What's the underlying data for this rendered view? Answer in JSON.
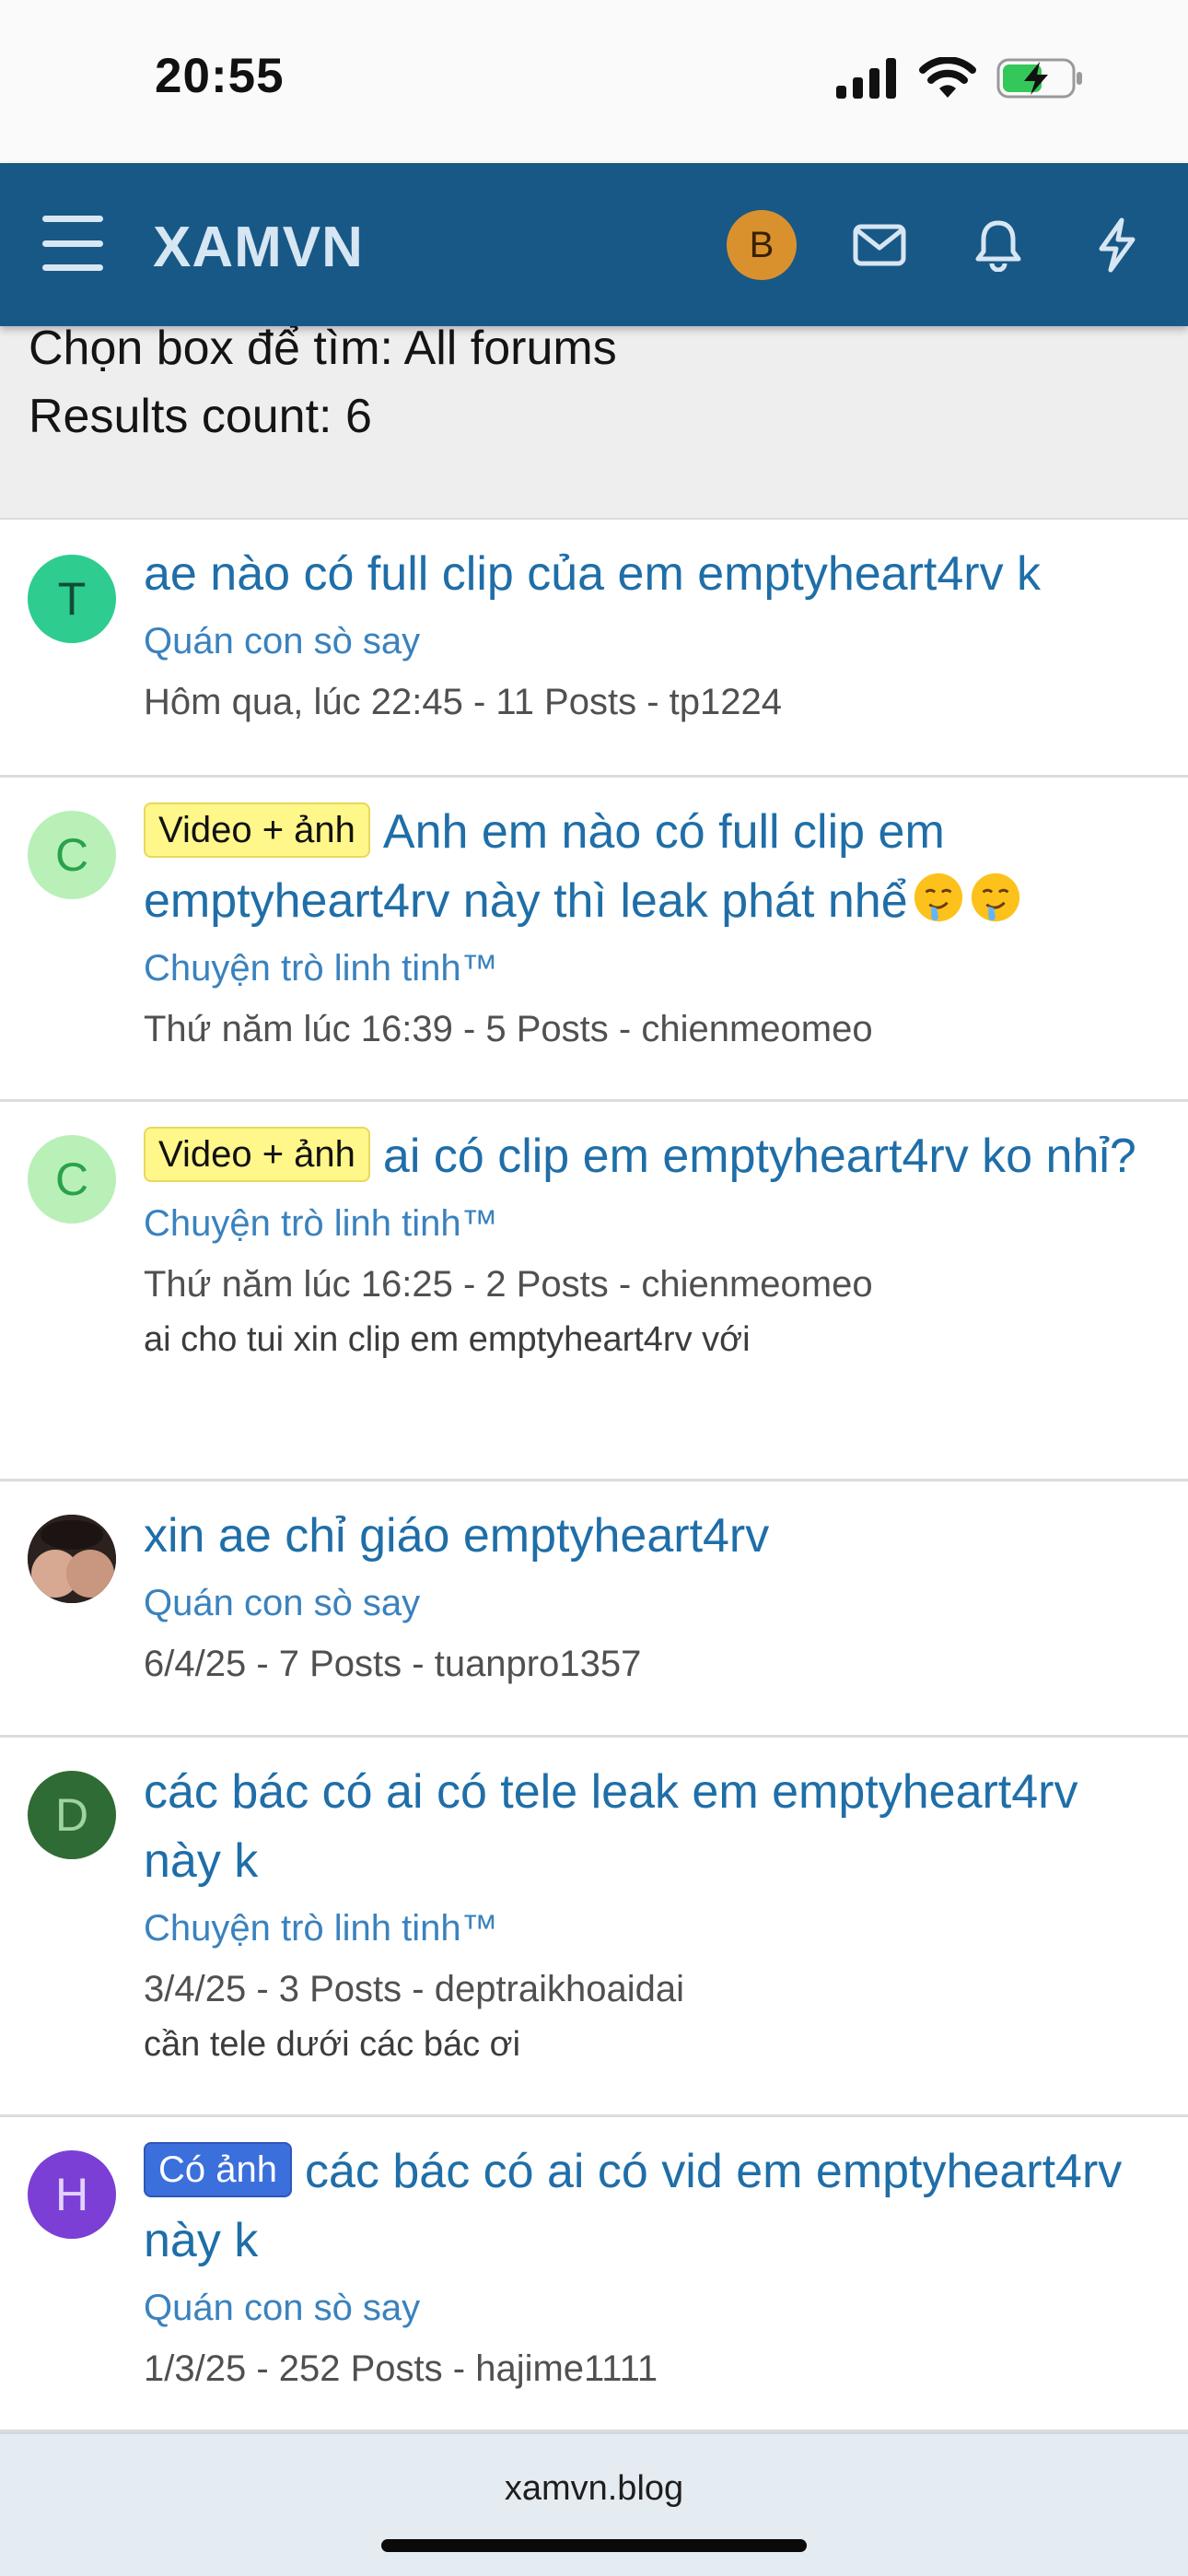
{
  "status_bar": {
    "time": "20:55",
    "icons": [
      "signal-icon",
      "wifi-icon",
      "battery-charging-icon"
    ]
  },
  "navbar": {
    "brand": "XAMVN",
    "avatar_letter": "B",
    "icons": [
      "menu-icon",
      "mail-icon",
      "bell-icon",
      "bolt-icon"
    ],
    "colors": {
      "background": "#185886",
      "avatar": "#d9912e"
    }
  },
  "filter": {
    "forum_line": "Chọn box để tìm: All forums",
    "count_line": "Results count: 6"
  },
  "results": [
    {
      "avatar_letter": "T",
      "avatar_color": "#2ecc8f",
      "label": "",
      "title": "ae nào có full clip của em emptyheart4rv k",
      "forum": "Quán con sò say",
      "meta": "Hôm qua, lúc 22:45 - 11 Posts - tp1224",
      "snippet": ""
    },
    {
      "avatar_letter": "C",
      "avatar_color": "#b8f0b8",
      "label": "Video + ảnh",
      "title": "Anh em nào có full clip em emptyheart4rv này thì leak phát nhể",
      "forum": "Chuyện trò linh tinh™",
      "meta": "Thứ năm lúc 16:39 - 5 Posts - chienmeomeo",
      "snippet": ""
    },
    {
      "avatar_letter": "C",
      "avatar_color": "#b8f0b8",
      "label": "Video + ảnh",
      "title": "ai có clip em emptyheart4rv ko nhỉ?",
      "forum": "Chuyện trò linh tinh™",
      "meta": "Thứ năm lúc 16:25 - 2 Posts - chienmeomeo",
      "snippet": "ai cho tui xin clip em emptyheart4rv với"
    },
    {
      "avatar_letter": "",
      "avatar_color": "#c79a84",
      "label": "",
      "title": "xin ae chỉ giáo emptyheart4rv",
      "forum": "Quán con sò say",
      "meta": "6/4/25 - 7 Posts - tuanpro1357",
      "snippet": ""
    },
    {
      "avatar_letter": "D",
      "avatar_color": "#2f6b34",
      "label": "",
      "title": "các bác có ai có tele leak em emptyheart4rv này k",
      "forum": "Chuyện trò linh tinh™",
      "meta": "3/4/25 - 3 Posts - deptraikhoaidai",
      "snippet": "cần tele dưới các bác ơi"
    },
    {
      "avatar_letter": "H",
      "avatar_color": "#7b3fd6",
      "label": "Có ảnh",
      "title": "các bác có ai có vid em emptyheart4rv này k",
      "forum": "Quán con sò say",
      "meta": "1/3/25 - 252 Posts - hajime1111",
      "snippet": ""
    }
  ],
  "bottom_bar": {
    "url": "xamvn.blog"
  }
}
